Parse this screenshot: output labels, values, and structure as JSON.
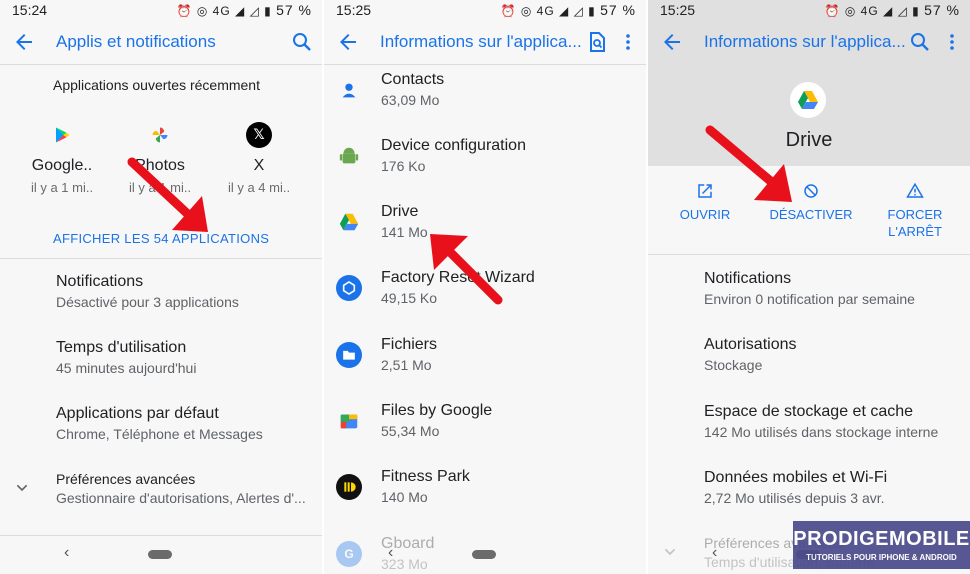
{
  "colors": {
    "accent": "#1a73e8",
    "arrow": "#e8111b",
    "hero_bg": "#e0e0e0",
    "watermark_bg": "#4a4a8c"
  },
  "screens": [
    {
      "status": {
        "time": "15:24",
        "battery": "57 %"
      },
      "header": {
        "title": "Applis et notifications"
      },
      "recent": {
        "title": "Applications ouvertes récemment",
        "apps": [
          {
            "name": "Google..",
            "time": "il y a 1 mi..",
            "icon": "google-play-icon"
          },
          {
            "name": "Photos",
            "time": "il y a 1 mi..",
            "icon": "google-photos-icon"
          },
          {
            "name": "X",
            "time": "il y a 4 mi..",
            "icon": "x-icon"
          }
        ],
        "show_all": "AFFICHER LES 54 APPLICATIONS"
      },
      "items": [
        {
          "title": "Notifications",
          "subtitle": "Désactivé pour 3 applications"
        },
        {
          "title": "Temps d'utilisation",
          "subtitle": "45 minutes aujourd'hui"
        },
        {
          "title": "Applications par défaut",
          "subtitle": "Chrome, Téléphone et Messages"
        },
        {
          "title": "Préférences avancées",
          "subtitle": "Gestionnaire d'autorisations, Alertes d'..."
        }
      ]
    },
    {
      "status": {
        "time": "15:25",
        "battery": "57 %"
      },
      "header": {
        "title": "Informations sur l'applica..."
      },
      "apps": [
        {
          "name": "Contacts",
          "size": "63,09 Mo",
          "icon": "contacts-icon"
        },
        {
          "name": "Device configuration",
          "size": "176 Ko",
          "icon": "android-icon"
        },
        {
          "name": "Drive",
          "size": "141 Mo",
          "icon": "google-drive-icon"
        },
        {
          "name": "Factory Reset Wizard",
          "size": "49,15 Ko",
          "icon": "factory-reset-icon"
        },
        {
          "name": "Fichiers",
          "size": "2,51 Mo",
          "icon": "folder-icon"
        },
        {
          "name": "Files by Google",
          "size": "55,34 Mo",
          "icon": "files-by-google-icon"
        },
        {
          "name": "Fitness Park",
          "size": "140 Mo",
          "icon": "fitness-park-icon"
        },
        {
          "name": "Gboard",
          "size": "323 Mo",
          "icon": "gboard-icon"
        }
      ]
    },
    {
      "status": {
        "time": "15:25",
        "battery": "57 %"
      },
      "header": {
        "title": "Informations sur l'applica..."
      },
      "app": {
        "name": "Drive",
        "icon": "google-drive-icon"
      },
      "actions": [
        {
          "label": "OUVRIR",
          "icon": "open-external-icon"
        },
        {
          "label": "DÉSACTIVER",
          "icon": "disable-icon"
        },
        {
          "label": "FORCER L'ARRÊT",
          "icon": "warning-icon"
        }
      ],
      "items": [
        {
          "title": "Notifications",
          "subtitle": "Environ 0 notification par semaine"
        },
        {
          "title": "Autorisations",
          "subtitle": "Stockage"
        },
        {
          "title": "Espace de stockage et cache",
          "subtitle": "142 Mo utilisés dans stockage interne"
        },
        {
          "title": "Données mobiles et Wi-Fi",
          "subtitle": "2,72 Mo utilisés depuis 3 avr."
        },
        {
          "title": "Préférences avancées",
          "subtitle": "Temps d'utilisation, Batterie..."
        }
      ]
    }
  ],
  "watermark": {
    "brand": "PRODIGEMOBILE",
    "tagline": "TUTORIELS POUR IPHONE & ANDROID"
  }
}
